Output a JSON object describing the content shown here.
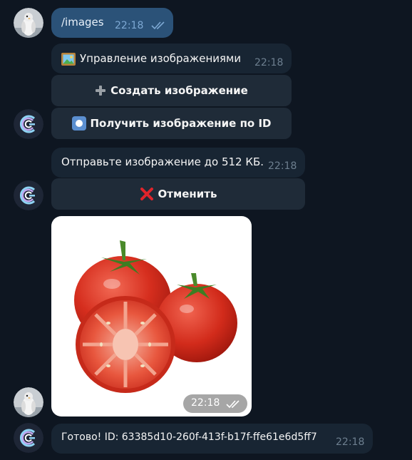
{
  "messages": {
    "cmd": {
      "text": "/images",
      "time": "22:18"
    },
    "menu": {
      "title": "Управление изображениями",
      "time": "22:18",
      "btn_create": "Создать изображение",
      "btn_get": "Получить изображение по ID"
    },
    "send": {
      "text": "Отправьте изображение до 512 КБ.",
      "time": "22:18",
      "btn_cancel": "Отменить"
    },
    "photo": {
      "time": "22:18"
    },
    "done": {
      "text": "Готово! ID: 63385d10-260f-413f-b17f-ffe61e6d5ff7",
      "time": "22:18"
    }
  },
  "icons": {
    "user_avatar": "penguin-avatar-icon",
    "bot_avatar": "bot-logo-icon",
    "read_receipt": "double-check-icon",
    "frame": "framed-picture-icon",
    "plus": "plus-icon",
    "record": "record-button-icon",
    "cross": "cross-mark-icon"
  },
  "colors": {
    "background": "#0e1621",
    "incoming_bubble": "#182533",
    "outgoing_bubble": "#2b5278",
    "inline_button": "#1f2b38",
    "cross_red": "#e0242b"
  }
}
